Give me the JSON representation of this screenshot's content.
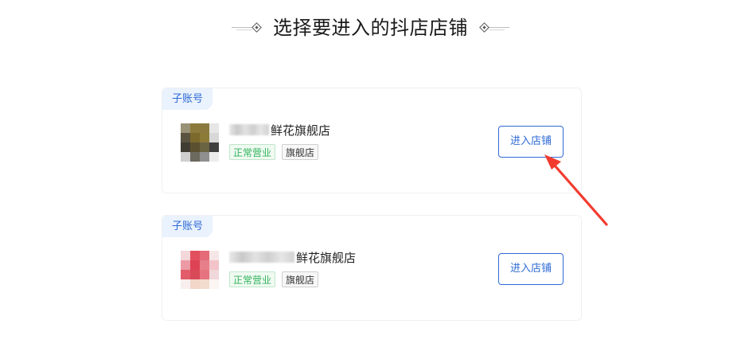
{
  "header": {
    "title": "选择要进入的抖店店铺"
  },
  "shops": [
    {
      "account_type": "子账号",
      "name_suffix": "鲜花旗舰店",
      "status_badge": "正常营业",
      "type_badge": "旗舰店",
      "enter_label": "进入店铺"
    },
    {
      "account_type": "子账号",
      "name_suffix": "鲜花旗舰店",
      "status_badge": "正常营业",
      "type_badge": "旗舰店",
      "enter_label": "进入店铺"
    }
  ],
  "colors": {
    "accent": "#2f6bd6",
    "status_green": "#2fb35a",
    "annotation_arrow": "#f23b2f"
  }
}
